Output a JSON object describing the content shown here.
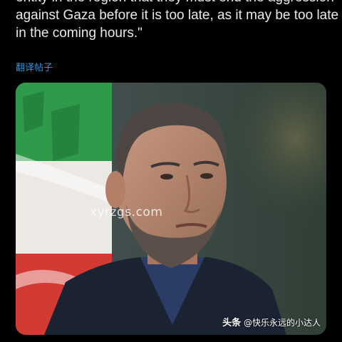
{
  "tweet": {
    "text_lines": [
      "entity in the region that they must end the aggression",
      "against Gaza before it is too late, as it may be too late",
      "in the coming hours.\""
    ],
    "translate_label": "翻译帖子"
  },
  "media": {
    "watermark": "xyrzgs.com",
    "alt_icon": "photo-of-man-in-front-of-iranian-flag"
  },
  "source_badge": {
    "brand": "头条",
    "handle": "@快乐永远的小达人"
  },
  "colors": {
    "background": "#000000",
    "text": "#e7e9ea",
    "link": "#1d9bf0"
  }
}
